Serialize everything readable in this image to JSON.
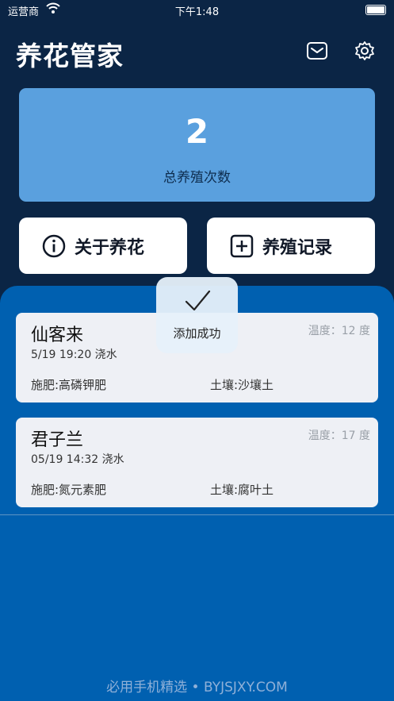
{
  "status_bar": {
    "carrier": "运营商",
    "time": "下午1:48"
  },
  "header": {
    "title": "养花管家"
  },
  "summary": {
    "count": "2",
    "label": "总养殖次数"
  },
  "actions": {
    "about_label": "关于养花",
    "records_label": "养殖记录"
  },
  "records": [
    {
      "name": "仙客来",
      "when": "5/19  19:20 浇水",
      "temp": "温度：12 度",
      "fertilizer": "施肥:高磷钾肥",
      "soil": "土壤:沙壤土"
    },
    {
      "name": "君子兰",
      "when": "05/19  14:32 浇水",
      "temp": "温度：17 度",
      "fertilizer": "施肥:氮元素肥",
      "soil": "土壤:腐叶土"
    }
  ],
  "toast": {
    "text": "添加成功"
  },
  "watermark": "必用手机精选 • BYJSJXY.COM",
  "colors": {
    "background": "#0b2545",
    "stat_card": "#5aa0de",
    "panel": "#0060b0",
    "card": "#eef0f5"
  },
  "icons": [
    "wifi-icon",
    "battery-icon",
    "mail-icon",
    "gear-icon",
    "info-icon",
    "plus-square-icon",
    "checkmark-icon"
  ]
}
